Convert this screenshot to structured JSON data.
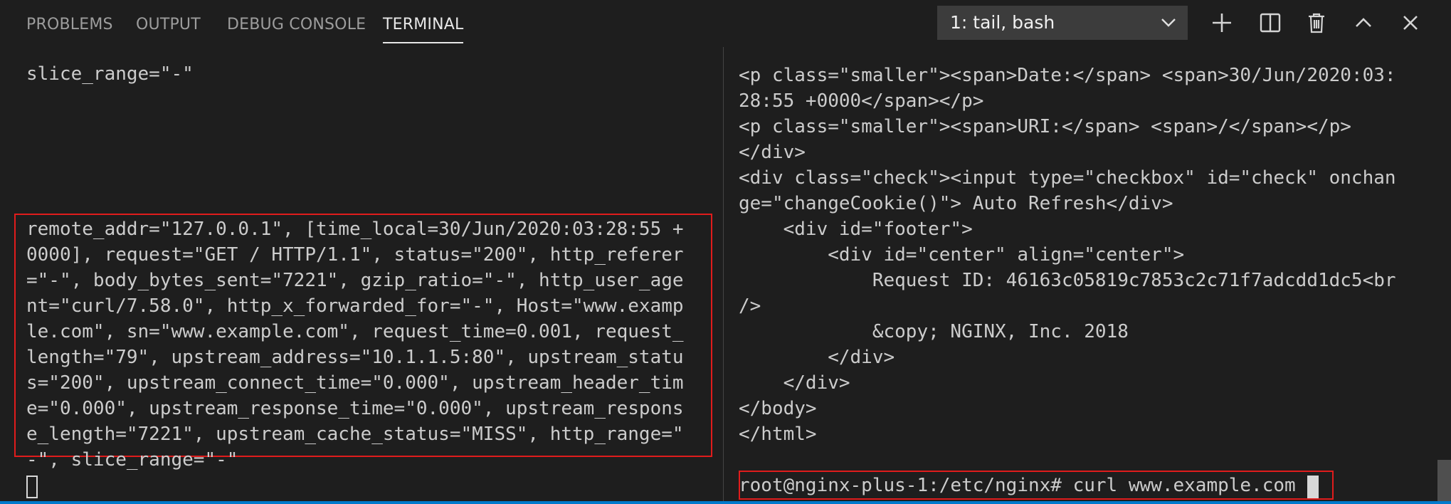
{
  "panel": {
    "tabs": [
      {
        "label": "PROBLEMS"
      },
      {
        "label": "OUTPUT"
      },
      {
        "label": "DEBUG CONSOLE"
      },
      {
        "label": "TERMINAL"
      }
    ],
    "active_tab": "TERMINAL",
    "terminal_select": "1: tail, bash",
    "actions": [
      "plus-icon",
      "split-icon",
      "trash-icon",
      "chevron-up-icon",
      "close-icon"
    ]
  },
  "left_terminal": {
    "top_line": "slice_range=\"-\"",
    "log_lines": [
      "remote_addr=\"127.0.0.1\", [time_local=30/Jun/2020:03:28:55 +",
      "0000], request=\"GET / HTTP/1.1\", status=\"200\", http_referer",
      "=\"-\", body_bytes_sent=\"7221\", gzip_ratio=\"-\", http_user_age",
      "nt=\"curl/7.58.0\", http_x_forwarded_for=\"-\", Host=\"www.examp",
      "le.com\", sn=\"www.example.com\", request_time=0.001, request_",
      "length=\"79\", upstream_address=\"10.1.1.5:80\", upstream_statu",
      "s=\"200\", upstream_connect_time=\"0.000\", upstream_header_tim",
      "e=\"0.000\", upstream_response_time=\"0.000\", upstream_respons",
      "e_length=\"7221\", upstream_cache_status=\"MISS\", http_range=\"",
      "-\", slice_range=\"-\""
    ]
  },
  "right_terminal": {
    "lines": [
      "<p class=\"smaller\"><span>Date:</span> <span>30/Jun/2020:03:",
      "28:55 +0000</span></p>",
      "<p class=\"smaller\"><span>URI:</span> <span>/</span></p>",
      "</div>",
      "<div class=\"check\"><input type=\"checkbox\" id=\"check\" onchan",
      "ge=\"changeCookie()\"> Auto Refresh</div>",
      "    <div id=\"footer\">",
      "        <div id=\"center\" align=\"center\">",
      "            Request ID: 46163c05819c7853c2c71f7adcdd1dc5<br",
      "/>",
      "            &copy; NGINX, Inc. 2018",
      "        </div>",
      "    </div>",
      "</body>",
      "</html>",
      ""
    ],
    "prompt": "root@nginx-plus-1:/etc/nginx# curl www.example.com"
  }
}
